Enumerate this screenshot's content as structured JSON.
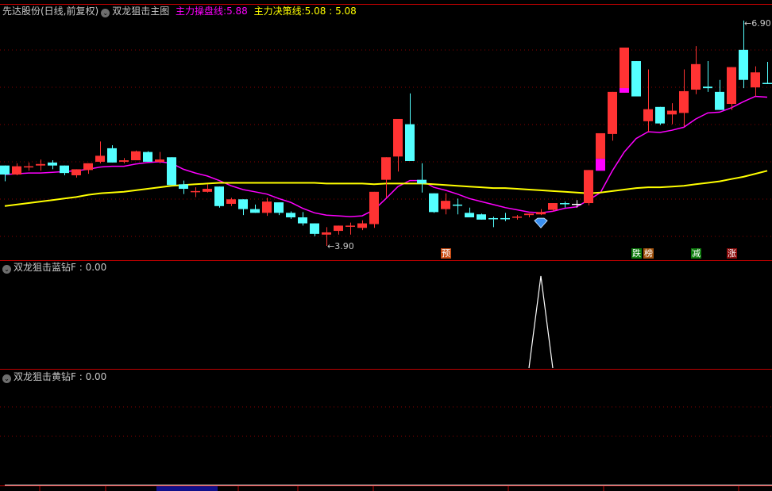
{
  "header": {
    "stock_name": "先达股份(日线,前复权)",
    "indicator_name": "双龙狙击主图",
    "line1_label": "主力操盘线:",
    "line1_value": "5.88",
    "line2_label": "主力决策线:",
    "line2_value": "5.08 : 5.08"
  },
  "panel2": {
    "title": "双龙狙击蓝钻F",
    "value": ": 0.00"
  },
  "panel3": {
    "title": "双龙狙击黄钻F",
    "value": ": 0.00"
  },
  "annotations": {
    "low_label": "3.90",
    "high_label": "6.90"
  },
  "signals": [
    {
      "text": "预",
      "index": 37,
      "color": "#c84a10"
    },
    {
      "text": "跌",
      "index": 53,
      "color": "#0a7a0a"
    },
    {
      "text": "榜",
      "index": 54,
      "color": "#a0500a"
    },
    {
      "text": "减",
      "index": 58,
      "color": "#0a7a0a"
    },
    {
      "text": "涨",
      "index": 61,
      "color": "#8a0a0a"
    }
  ],
  "colors": {
    "up": "#ff3333",
    "down": "#54ffff",
    "ma_fast": "#ff00ff",
    "ma_slow": "#ffff00",
    "grid": "#8a0000",
    "border": "#c00000",
    "doji": "#ffffff"
  },
  "chart_data": {
    "type": "candlestick",
    "title": "先达股份(日线,前复权)",
    "ylim": [
      3.9,
      6.9
    ],
    "candles": [
      [
        4.97,
        4.97,
        4.76,
        4.85
      ],
      [
        4.85,
        5.0,
        4.84,
        4.96
      ],
      [
        4.96,
        5.01,
        4.9,
        4.96
      ],
      [
        4.97,
        5.05,
        4.9,
        4.99
      ],
      [
        5.01,
        5.04,
        4.92,
        4.97
      ],
      [
        4.97,
        4.97,
        4.84,
        4.87
      ],
      [
        4.84,
        4.92,
        4.81,
        4.92
      ],
      [
        4.91,
        5.0,
        4.86,
        5.0
      ],
      [
        5.02,
        5.29,
        5.0,
        5.1
      ],
      [
        5.2,
        5.24,
        5.01,
        5.01
      ],
      [
        5.02,
        5.07,
        5.0,
        5.04
      ],
      [
        5.04,
        5.17,
        5.04,
        5.16
      ],
      [
        5.15,
        5.16,
        5.02,
        5.02
      ],
      [
        5.02,
        5.15,
        5.0,
        5.05
      ],
      [
        5.08,
        5.08,
        4.71,
        4.71
      ],
      [
        4.72,
        4.77,
        4.59,
        4.66
      ],
      [
        4.62,
        4.68,
        4.55,
        4.63
      ],
      [
        4.62,
        4.72,
        4.61,
        4.66
      ],
      [
        4.69,
        4.69,
        4.41,
        4.43
      ],
      [
        4.46,
        4.54,
        4.43,
        4.52
      ],
      [
        4.52,
        4.52,
        4.31,
        4.39
      ],
      [
        4.39,
        4.45,
        4.34,
        4.34
      ],
      [
        4.34,
        4.54,
        4.3,
        4.49
      ],
      [
        4.48,
        4.48,
        4.31,
        4.34
      ],
      [
        4.34,
        4.36,
        4.26,
        4.28
      ],
      [
        4.28,
        4.35,
        4.17,
        4.2
      ],
      [
        4.2,
        4.2,
        4.03,
        4.06
      ],
      [
        4.05,
        4.15,
        3.9,
        4.08
      ],
      [
        4.1,
        4.17,
        4.05,
        4.17
      ],
      [
        4.16,
        4.21,
        4.05,
        4.17
      ],
      [
        4.14,
        4.24,
        4.11,
        4.2
      ],
      [
        4.19,
        4.62,
        4.14,
        4.62
      ],
      [
        4.78,
        5.08,
        4.54,
        5.08
      ],
      [
        5.09,
        5.59,
        4.89,
        5.59
      ],
      [
        5.52,
        5.93,
        5.03,
        5.03
      ],
      [
        4.78,
        5.0,
        4.61,
        4.73
      ],
      [
        4.6,
        4.6,
        4.34,
        4.35
      ],
      [
        4.39,
        4.6,
        4.32,
        4.5
      ],
      [
        4.45,
        4.53,
        4.32,
        4.44
      ],
      [
        4.34,
        4.41,
        4.28,
        4.28
      ],
      [
        4.32,
        4.33,
        4.25,
        4.25
      ],
      [
        4.27,
        4.29,
        4.15,
        4.26
      ],
      [
        4.27,
        4.34,
        4.23,
        4.26
      ],
      [
        4.28,
        4.31,
        4.25,
        4.29
      ],
      [
        4.31,
        4.33,
        4.28,
        4.33
      ],
      [
        4.32,
        4.39,
        4.31,
        4.35
      ],
      [
        4.38,
        4.47,
        4.36,
        4.47
      ],
      [
        4.47,
        4.49,
        4.41,
        4.46
      ],
      [
        4.46,
        4.51,
        4.41,
        4.46
      ],
      [
        4.47,
        4.91,
        4.44,
        4.91
      ],
      [
        5.06,
        5.4,
        4.91,
        5.4
      ],
      [
        5.39,
        5.95,
        5.3,
        5.95
      ],
      [
        5.94,
        6.54,
        5.94,
        6.54
      ],
      [
        6.36,
        6.36,
        5.89,
        5.89
      ],
      [
        5.56,
        6.25,
        5.42,
        5.72
      ],
      [
        5.75,
        5.75,
        5.51,
        5.53
      ],
      [
        5.65,
        5.8,
        5.52,
        5.7
      ],
      [
        5.67,
        6.25,
        5.49,
        5.96
      ],
      [
        5.98,
        6.56,
        5.92,
        6.32
      ],
      [
        6.02,
        6.36,
        5.95,
        6.0
      ],
      [
        5.95,
        6.11,
        5.71,
        5.71
      ],
      [
        5.79,
        6.28,
        5.71,
        6.28
      ],
      [
        6.51,
        6.9,
        6.0,
        6.11
      ],
      [
        6.01,
        6.29,
        5.89,
        6.21
      ],
      [
        6.07,
        6.35,
        6.06,
        6.06
      ]
    ],
    "candle_fields": [
      "open",
      "high",
      "low",
      "close"
    ],
    "doji_white_index": 48,
    "magenta_blocks": [
      {
        "index": 50,
        "range": [
          4.9,
          5.06
        ]
      },
      {
        "index": 52,
        "range": [
          5.94,
          6.0
        ]
      }
    ],
    "series": [
      {
        "name": "主力操盘线",
        "values": [
          4.85,
          4.86,
          4.87,
          4.87,
          4.88,
          4.89,
          4.9,
          4.92,
          4.95,
          4.96,
          4.96,
          4.99,
          5.01,
          5.02,
          5.0,
          4.92,
          4.87,
          4.83,
          4.77,
          4.7,
          4.65,
          4.62,
          4.59,
          4.53,
          4.48,
          4.4,
          4.34,
          4.31,
          4.3,
          4.29,
          4.3,
          4.38,
          4.53,
          4.69,
          4.77,
          4.77,
          4.68,
          4.64,
          4.59,
          4.53,
          4.49,
          4.45,
          4.41,
          4.38,
          4.35,
          4.34,
          4.36,
          4.4,
          4.42,
          4.51,
          4.61,
          4.9,
          5.15,
          5.33,
          5.42,
          5.41,
          5.44,
          5.48,
          5.59,
          5.67,
          5.68,
          5.74,
          5.82,
          5.89,
          5.88
        ]
      },
      {
        "name": "主力决策线",
        "values": [
          4.43,
          4.45,
          4.47,
          4.49,
          4.51,
          4.53,
          4.55,
          4.58,
          4.6,
          4.61,
          4.62,
          4.64,
          4.66,
          4.68,
          4.7,
          4.71,
          4.72,
          4.73,
          4.74,
          4.74,
          4.74,
          4.74,
          4.74,
          4.74,
          4.74,
          4.74,
          4.74,
          4.73,
          4.73,
          4.73,
          4.73,
          4.72,
          4.73,
          4.73,
          4.73,
          4.73,
          4.72,
          4.71,
          4.7,
          4.69,
          4.68,
          4.67,
          4.67,
          4.66,
          4.65,
          4.64,
          4.63,
          4.62,
          4.61,
          4.6,
          4.61,
          4.63,
          4.65,
          4.67,
          4.68,
          4.68,
          4.69,
          4.7,
          4.72,
          4.74,
          4.76,
          4.79,
          4.82,
          4.86,
          4.9
        ]
      }
    ],
    "blue_diamond": {
      "values_nonzero": [
        {
          "index": 45,
          "value": 1
        }
      ],
      "ylim": [
        0,
        1
      ]
    },
    "yellow_diamond": {
      "values_nonzero": [],
      "ylim": [
        0,
        1
      ]
    }
  }
}
